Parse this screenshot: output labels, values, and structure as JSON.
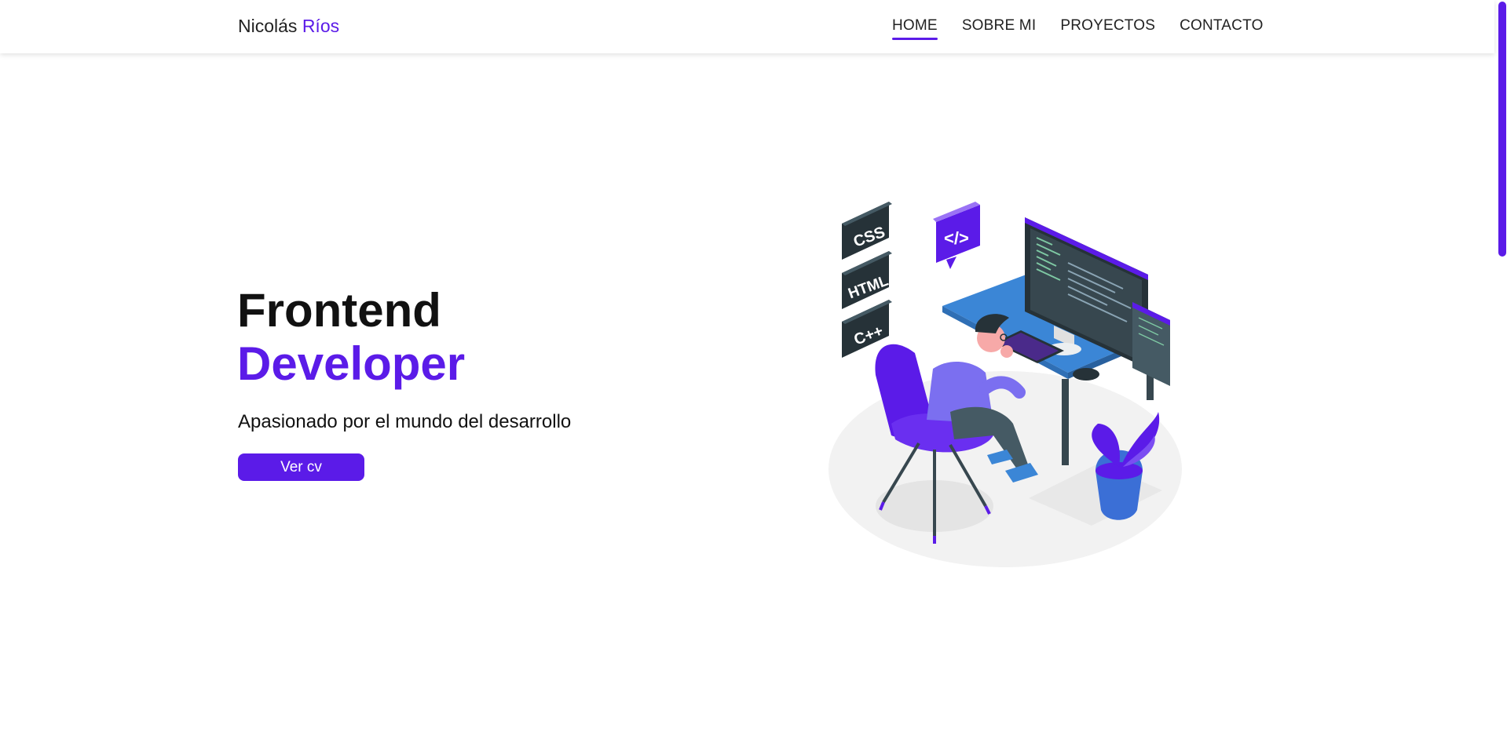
{
  "nav": {
    "brand_first": "Nicolás",
    "brand_last": "Ríos",
    "links": [
      {
        "label": "HOME",
        "active": true
      },
      {
        "label": "SOBRE MI",
        "active": false
      },
      {
        "label": "PROYECTOS",
        "active": false
      },
      {
        "label": "CONTACTO",
        "active": false
      }
    ]
  },
  "hero": {
    "title_line1": "Frontend",
    "title_line2": "Developer",
    "subtitle": "Apasionado por el mundo del desarrollo",
    "cv_button": "Ver cv"
  },
  "illustration": {
    "badges": [
      "CSS",
      "HTML",
      "C++"
    ],
    "code_bubble": "</>"
  },
  "colors": {
    "accent": "#5b1be8",
    "text": "#111111",
    "desk": "#3b86d6",
    "dark_block": "#37474f"
  }
}
